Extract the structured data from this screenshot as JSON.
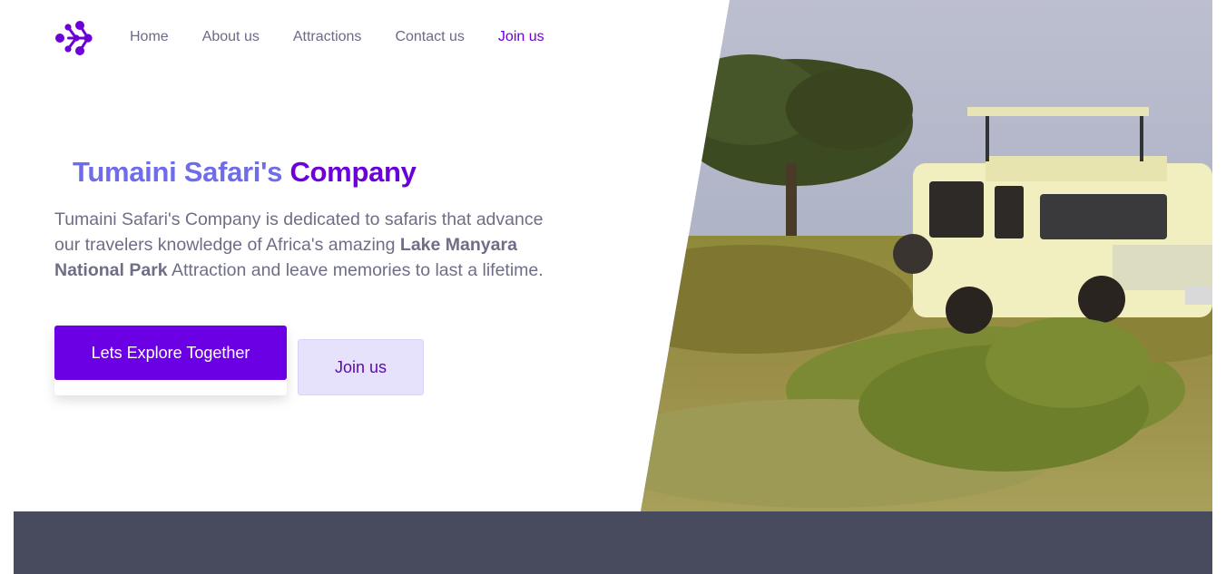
{
  "nav": {
    "items": [
      {
        "label": "Home"
      },
      {
        "label": "About us"
      },
      {
        "label": "Attractions"
      },
      {
        "label": "Contact us"
      },
      {
        "label": "Join us"
      }
    ],
    "active_index": 4
  },
  "hero": {
    "title_part1": "Tumaini Safari's",
    "title_part2": "Company",
    "desc_intro": "Tumaini Safari's Company is dedicated to safaris that advance our travelers knowledge of Africa's amazing",
    "desc_highlight": "Lake Manyara National Park",
    "desc_outro": "Attraction and leave memories to last a lifetime.",
    "primary_button": "Lets Explore Together",
    "secondary_button": "Join us",
    "image": "safari-vehicle-photo"
  },
  "colors": {
    "accent": "#6c00e4",
    "title_light": "#6f6cec",
    "text_muted": "#6e6e86",
    "secondary_bg": "#e6e2fc",
    "footer_band": "#484b5d"
  },
  "icons": {
    "logo": "molecule-logo-icon"
  }
}
